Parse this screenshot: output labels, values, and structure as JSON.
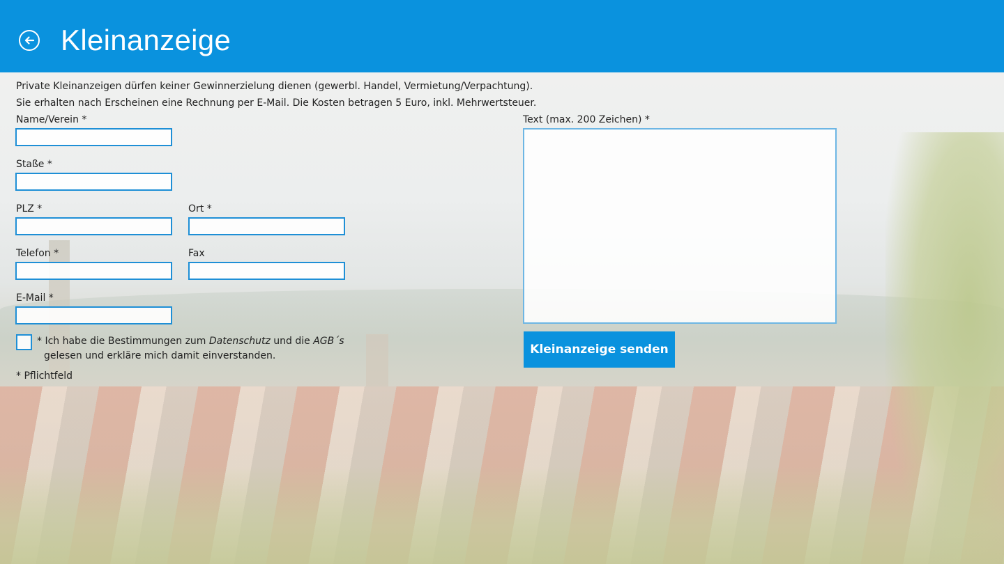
{
  "header": {
    "title": "Kleinanzeige",
    "back_icon": "back-arrow-circle-icon",
    "color": "#0a92de"
  },
  "info": {
    "line1": "Private Kleinanzeigen dürfen keiner Gewinnerzielung dienen (gewerbl. Handel, Vermietung/Verpachtung).",
    "line2": "Sie erhalten nach Erscheinen eine Rechnung per E-Mail. Die Kosten betragen 5 Euro, inkl. Mehrwertsteuer."
  },
  "form": {
    "name_label": "Name/Verein *",
    "street_label": "Staße *",
    "zip_label": "PLZ *",
    "city_label": "Ort *",
    "phone_label": "Telefon *",
    "fax_label": "Fax",
    "email_label": "E-Mail *",
    "text_label": "Text (max. 200 Zeichen) *",
    "name_value": "",
    "street_value": "",
    "zip_value": "",
    "city_value": "",
    "phone_value": "",
    "fax_value": "",
    "email_value": "",
    "text_value": ""
  },
  "consent": {
    "prefix": "* Ich habe die Bestimmungen zum ",
    "privacy_link": "Datenschutz",
    "middle": " und die ",
    "terms_link": "AGB´s",
    "line2": "gelesen und erkläre mich damit einverstanden.",
    "checked": false
  },
  "required_note": "* Pflichtfeld",
  "submit_label": "Kleinanzeige senden"
}
